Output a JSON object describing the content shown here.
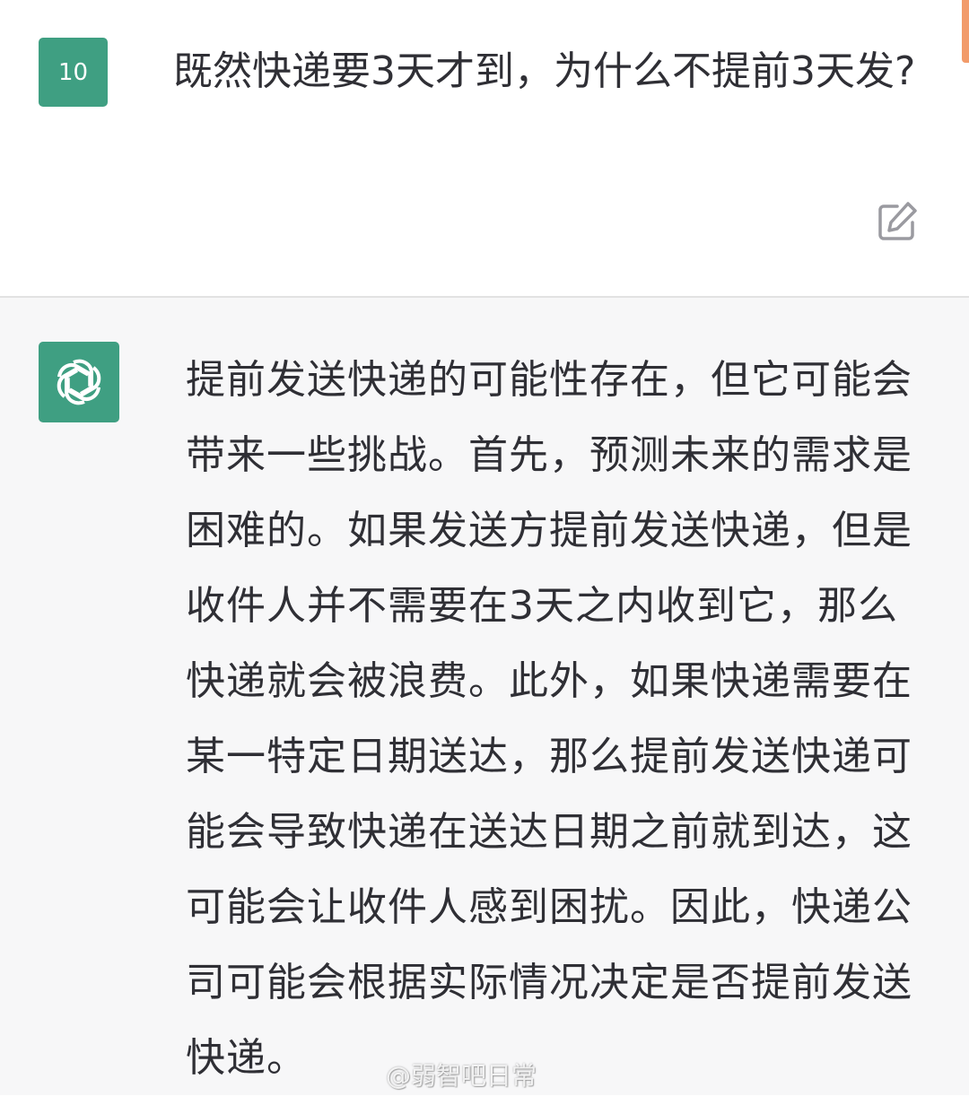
{
  "conversation": {
    "user": {
      "avatar_text": "10",
      "message": "既然快递要3天才到，为什么不提前3天发?",
      "edit_icon": "edit-icon",
      "avatar_color": "#3f9f82"
    },
    "assistant": {
      "avatar_icon": "openai-logo-icon",
      "message": "提前发送快递的可能性存在，但它可能会带来一些挑战。首先，预测未来的需求是困难的。如果发送方提前发送快递，但是收件人并不需要在3天之内收到它，那么快递就会被浪费。此外，如果快递需要在某一特定日期送达，那么提前发送快递可能会导致快递在送达日期之前就到达，这可能会让收件人感到困扰。因此，快递公司可能会根据实际情况决定是否提前发送快递。",
      "background_color": "#f7f7f8"
    }
  },
  "watermark": {
    "text": "@弱智吧日常"
  },
  "colors": {
    "accent": "#3f9f82",
    "scroll_indicator": "#f29b6a"
  }
}
